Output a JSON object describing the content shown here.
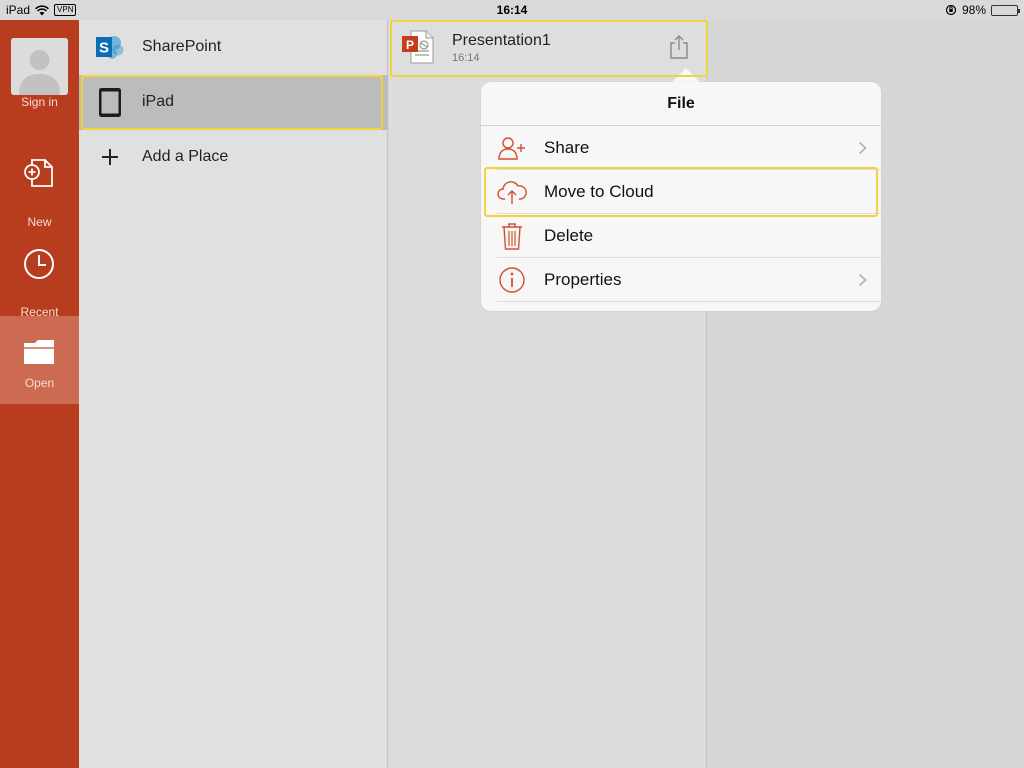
{
  "status_bar": {
    "device": "iPad",
    "vpn": "VPN",
    "time": "16:14",
    "battery": "98%",
    "battery_level": 0.98,
    "battery_color": "#4cd964"
  },
  "rail": {
    "items": [
      {
        "label": "Sign in",
        "icon": "avatar-icon"
      },
      {
        "label": "New",
        "icon": "new-document-icon"
      },
      {
        "label": "Recent",
        "icon": "clock-icon"
      },
      {
        "label": "Open",
        "icon": "folder-icon"
      }
    ],
    "active": "Open",
    "bg_color": "#b83c1e",
    "active_color": "#cd6a52"
  },
  "places": {
    "items": [
      {
        "label": "SharePoint",
        "icon": "sharepoint-icon"
      },
      {
        "label": "iPad",
        "icon": "ipad-icon"
      },
      {
        "label": "Add a Place",
        "icon": "plus-icon"
      }
    ],
    "selected": "iPad"
  },
  "files": {
    "items": [
      {
        "name": "Presentation1",
        "time": "16:14",
        "icon": "powerpoint-file-icon",
        "action_icon": "share-icon"
      }
    ]
  },
  "popover": {
    "title": "File",
    "items": [
      {
        "label": "Share",
        "icon": "add-person-icon",
        "chevron": true
      },
      {
        "label": "Move to Cloud",
        "icon": "cloud-upload-icon",
        "chevron": false
      },
      {
        "label": "Delete",
        "icon": "trash-icon",
        "chevron": false
      },
      {
        "label": "Properties",
        "icon": "info-icon",
        "chevron": true
      }
    ],
    "accent_color": "#d2502c"
  },
  "highlight_color": "#f2d33a"
}
